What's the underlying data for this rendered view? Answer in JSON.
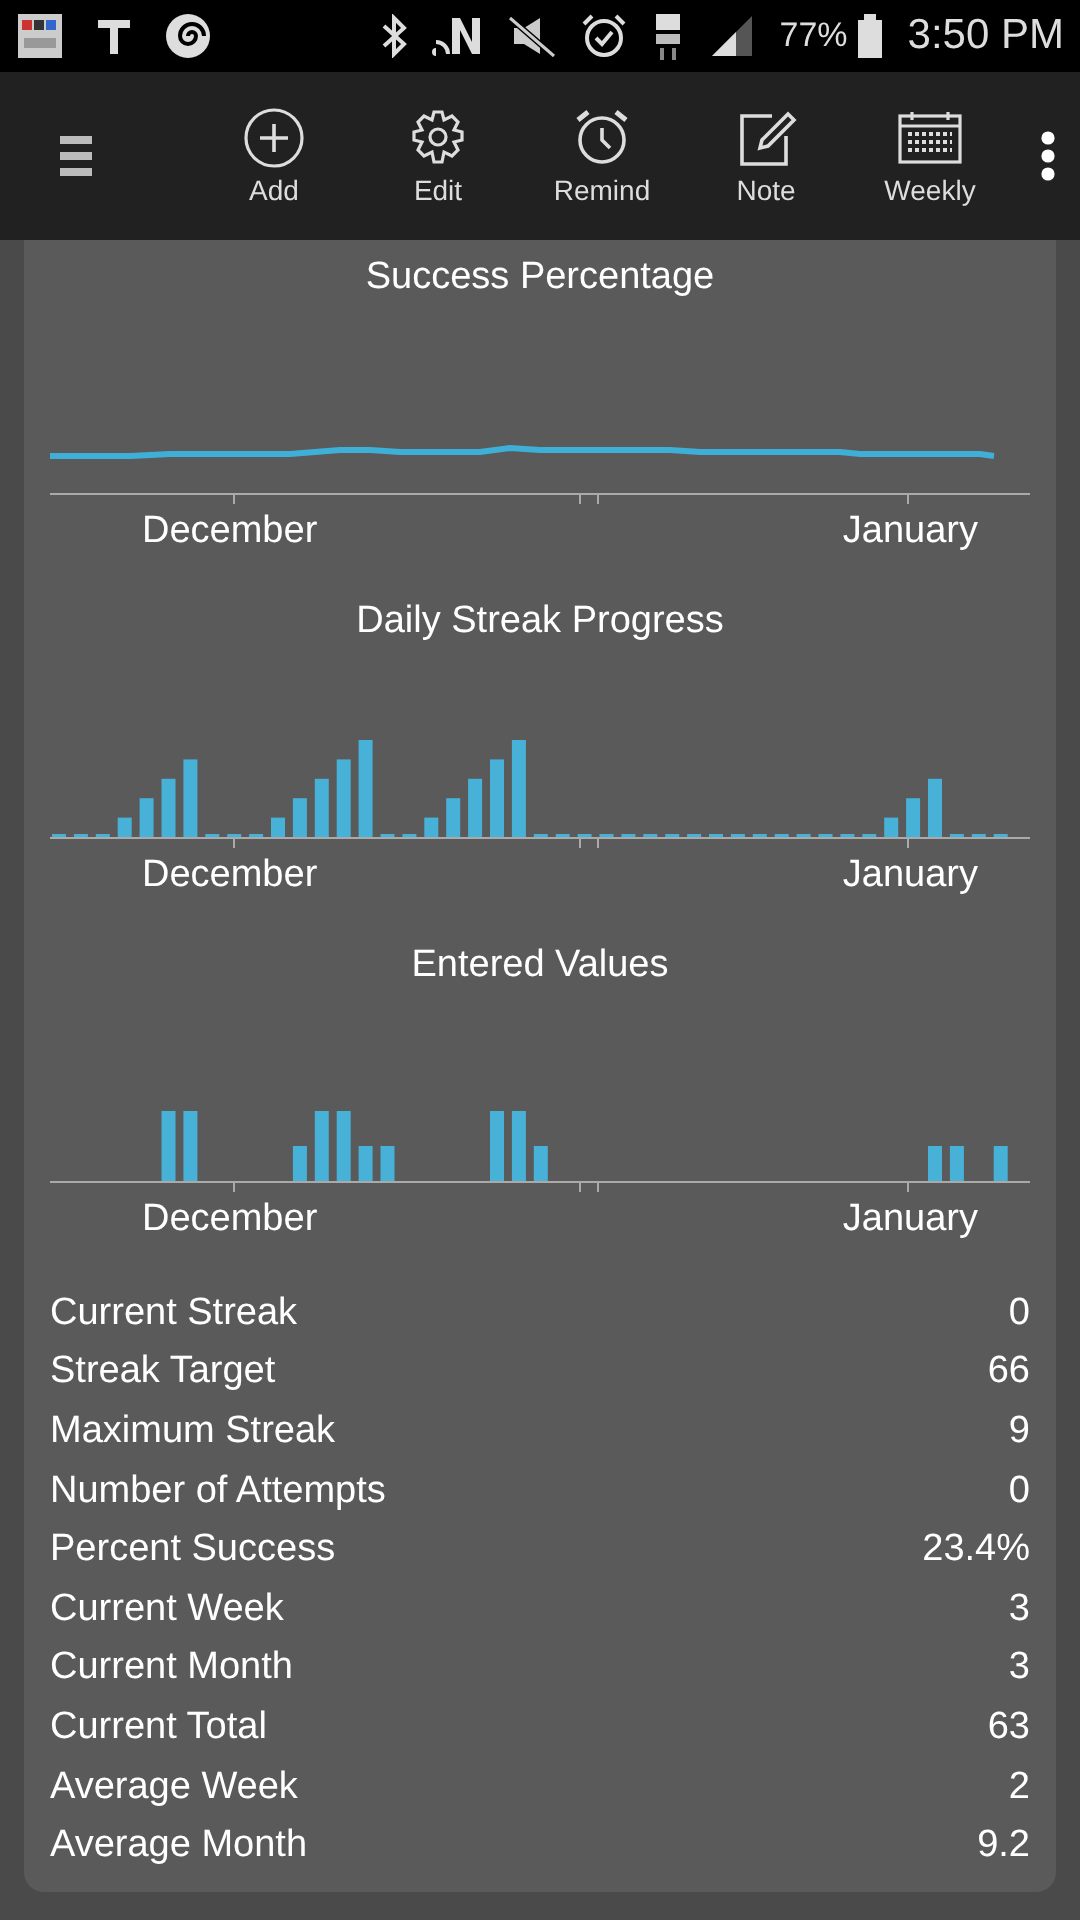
{
  "status_bar": {
    "battery": "77%",
    "time": "3:50 PM"
  },
  "toolbar": {
    "actions": [
      {
        "kind": "add",
        "label": "Add"
      },
      {
        "kind": "edit",
        "label": "Edit"
      },
      {
        "kind": "remind",
        "label": "Remind"
      },
      {
        "kind": "note",
        "label": "Note"
      },
      {
        "kind": "weekly",
        "label": "Weekly"
      }
    ]
  },
  "charts": [
    {
      "kind": "line",
      "title": "Success Percentage",
      "x_labels": [
        "December",
        "January"
      ]
    },
    {
      "kind": "streak",
      "title": "Daily Streak Progress",
      "x_labels": [
        "December",
        "January"
      ]
    },
    {
      "kind": "values",
      "title": "Entered Values",
      "x_labels": [
        "December",
        "January"
      ]
    }
  ],
  "stats": [
    {
      "label": "Current Streak",
      "value": "0"
    },
    {
      "label": "Streak Target",
      "value": "66"
    },
    {
      "label": "Maximum Streak",
      "value": "9"
    },
    {
      "label": "Number of Attempts",
      "value": "0"
    },
    {
      "label": "Percent Success",
      "value": "23.4%"
    },
    {
      "label": "Current Week",
      "value": "3"
    },
    {
      "label": "Current Month",
      "value": "3"
    },
    {
      "label": "Current Total",
      "value": "63"
    },
    {
      "label": "Average Week",
      "value": "2"
    },
    {
      "label": "Average Month",
      "value": "9.2"
    }
  ]
}
